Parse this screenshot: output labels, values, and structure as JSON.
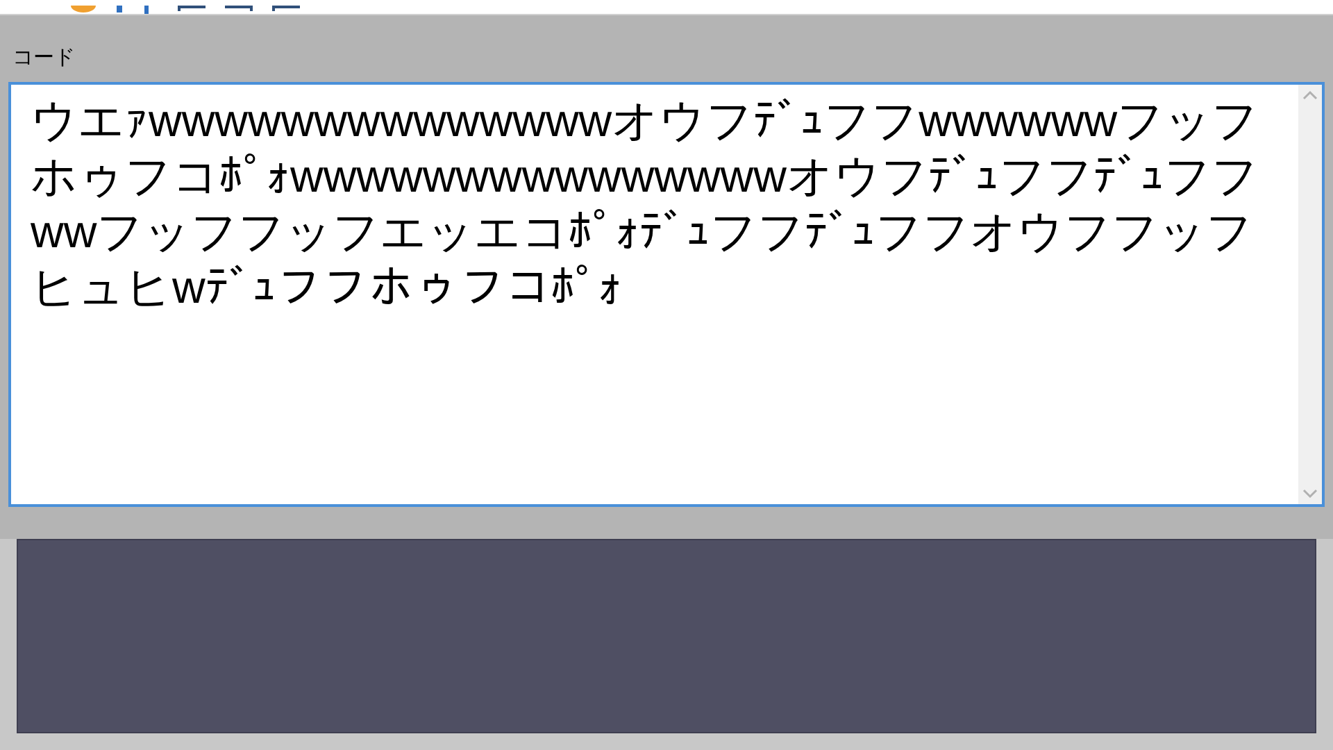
{
  "code_panel": {
    "label": "コード",
    "value": "ウエｧwwwwwwwwwwwwwwオウフﾃﾞｭフフwwwwwwフッフホゥフコﾎﾟｫwwwwwwwwwwwwwwwオウフﾃﾞｭフフﾃﾞｭフフwwフッフフッフエッエコﾎﾟｫﾃﾞｭフフﾃﾞｭフフオウフフッフヒュヒwﾃﾞｭフフホゥフコﾎﾟｫ"
  }
}
